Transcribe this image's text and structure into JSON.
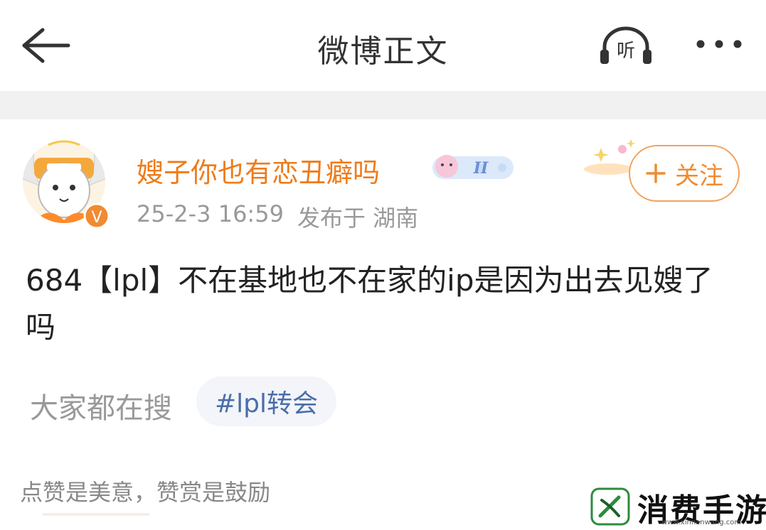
{
  "header": {
    "title": "微博正文",
    "listen_label": "听"
  },
  "post": {
    "username": "嫂子你也有恋丑癖吗",
    "timestamp": "25-2-3 16:59",
    "location": "发布于 湖南",
    "follow_label": "关注",
    "content": "684【lpl】不在基地也不在家的ip是因为出去见嫂了吗",
    "verified_mark": "V",
    "badge_text": "II"
  },
  "search": {
    "label": "大家都在搜",
    "hashtag": "#lpl转会"
  },
  "reward_hint": "点赞是美意，赞赏是鼓励",
  "watermark": {
    "text": "消费手游网",
    "url": "www.xinnanwang.com"
  },
  "colors": {
    "accent": "#ef7b1a",
    "link": "#4a6ea9",
    "muted": "#999999"
  }
}
